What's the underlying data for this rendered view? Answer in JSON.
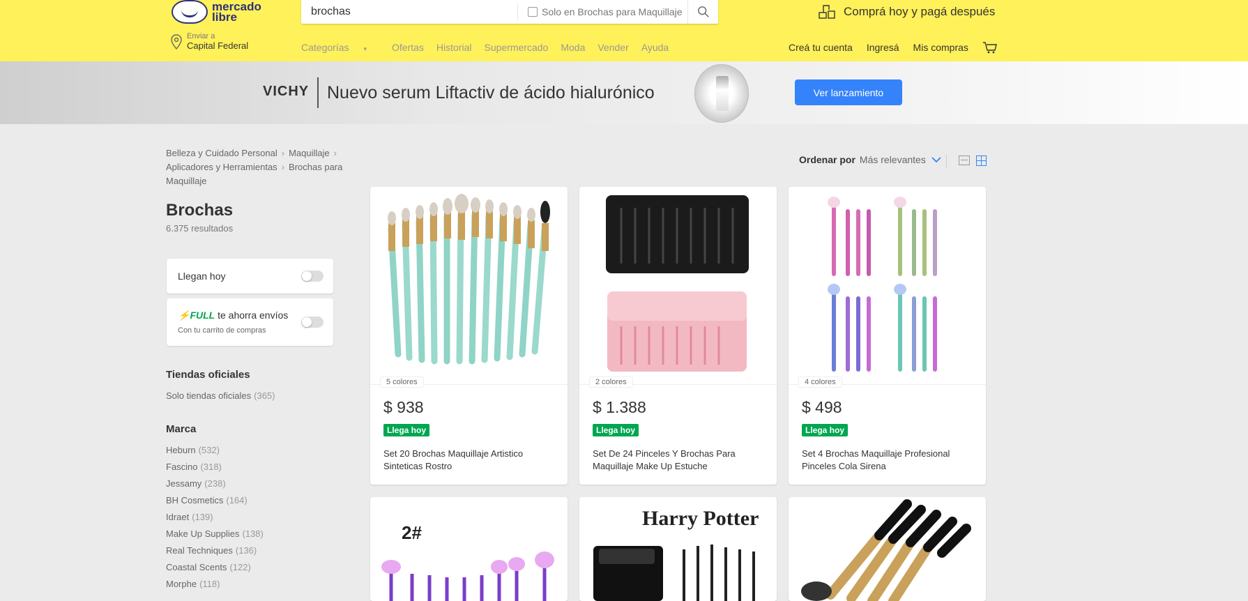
{
  "header": {
    "logo_line1": "mercado",
    "logo_line2": "libre",
    "search_value": "brochas",
    "search_scope": "Solo en Brochas para Maquillaje",
    "promo": "Comprá hoy y pagá después",
    "location_small": "Enviar a",
    "location_big": "Capital Federal",
    "nav": [
      "Categorías",
      "Ofertas",
      "Historial",
      "Supermercado",
      "Moda",
      "Vender",
      "Ayuda"
    ],
    "account": [
      "Creá tu cuenta",
      "Ingresá",
      "Mis compras"
    ]
  },
  "banner": {
    "brand": "VICHY",
    "headline": "Nuevo serum Liftactiv de ácido hialurónico",
    "cta": "Ver lanzamiento"
  },
  "breadcrumb": [
    "Belleza y Cuidado Personal",
    "Maquillaje",
    "Aplicadores y Herramientas",
    "Brochas para Maquillaje"
  ],
  "page": {
    "title": "Brochas",
    "results": "6.375 resultados"
  },
  "filters": {
    "today": "Llegan hoy",
    "full_badge": "FULL",
    "full_text": "te ahorra envíos",
    "full_note": "Con tu carrito de compras"
  },
  "official_stores": {
    "title": "Tiendas oficiales",
    "item": "Solo tiendas oficiales",
    "count": "(365)"
  },
  "brands": {
    "title": "Marca",
    "items": [
      {
        "name": "Heburn",
        "count": "(532)"
      },
      {
        "name": "Fascino",
        "count": "(318)"
      },
      {
        "name": "Jessamy",
        "count": "(238)"
      },
      {
        "name": "BH Cosmetics",
        "count": "(164)"
      },
      {
        "name": "Idraet",
        "count": "(139)"
      },
      {
        "name": "Make Up Supplies",
        "count": "(138)"
      },
      {
        "name": "Real Techniques",
        "count": "(136)"
      },
      {
        "name": "Coastal Scents",
        "count": "(122)"
      },
      {
        "name": "Morphe",
        "count": "(118)"
      }
    ]
  },
  "sort": {
    "label": "Ordenar por",
    "value": "Más relevantes"
  },
  "products": [
    {
      "colors": "5 colores",
      "price": "$ 938",
      "badge": "Llega hoy",
      "title": "Set 20 Brochas Maquillaje Artistico Sinteticas Rostro"
    },
    {
      "colors": "2 colores",
      "price": "$ 1.388",
      "badge": "Llega hoy",
      "title": "Set De 24 Pinceles Y Brochas Para Maquillaje Make Up Estuche"
    },
    {
      "colors": "4 colores",
      "price": "$ 498",
      "badge": "Llega hoy",
      "title": "Set 4 Brochas Maquillaje Profesional Pinceles Cola Sirena"
    }
  ],
  "second_row": {
    "label_2": "2#",
    "harry": "Harry Potter"
  },
  "colors": {
    "accent": "#3483fa",
    "header": "#fff159",
    "green": "#00a650"
  }
}
